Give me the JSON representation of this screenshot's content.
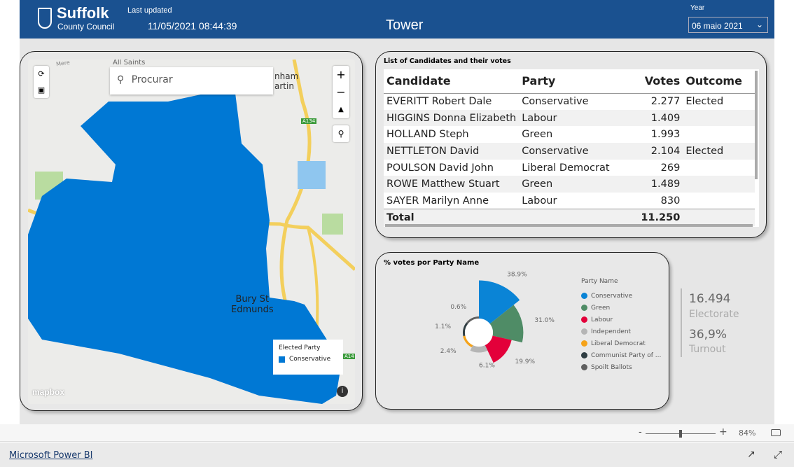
{
  "header": {
    "logo_line1": "Suffolk",
    "logo_line2": "County Council",
    "last_updated_label": "Last updated",
    "last_updated_value": "11/05/2021 08:44:39",
    "title": "Tower",
    "year_label": "Year",
    "year_value": "06 maio 2021"
  },
  "map": {
    "search_placeholder": "Procurar",
    "labels": [
      "All Saints",
      "Bury St\nEdmunds",
      "A134",
      "A14",
      "Mere",
      "nham\nartin"
    ],
    "legend_title": "Elected Party",
    "legend_item": "Conservative",
    "legend_color": "#0078d4",
    "attribution": "mapbox"
  },
  "table": {
    "title": "List of Candidates and their votes",
    "columns": [
      "Candidate",
      "Party",
      "Votes",
      "Outcome"
    ],
    "rows": [
      [
        "EVERITT Robert Dale",
        "Conservative",
        "2.277",
        "Elected"
      ],
      [
        "HIGGINS Donna Elizabeth",
        "Labour",
        "1.409",
        ""
      ],
      [
        "HOLLAND Steph",
        "Green",
        "1.993",
        ""
      ],
      [
        "NETTLETON David",
        "Conservative",
        "2.104",
        "Elected"
      ],
      [
        "POULSON David John",
        "Liberal Democrat",
        "269",
        ""
      ],
      [
        "ROWE Matthew Stuart",
        "Green",
        "1.489",
        ""
      ],
      [
        "SAYER Marilyn Anne",
        "Labour",
        "830",
        ""
      ]
    ],
    "total_label": "Total",
    "total_votes": "11.250"
  },
  "chart_data": {
    "type": "pie",
    "title": "% votes por Party Name",
    "legend_title": "Party Name",
    "legend_position": "right",
    "series": [
      {
        "name": "Conservative",
        "value": 38.9,
        "label": "38.9%",
        "color": "#0a84d6"
      },
      {
        "name": "Green",
        "value": 31.0,
        "label": "31.0%",
        "color": "#4f8c66"
      },
      {
        "name": "Labour",
        "value": 19.9,
        "label": "19.9%",
        "color": "#e3003a"
      },
      {
        "name": "Independent",
        "value": 6.1,
        "label": "6.1%",
        "color": "#b5b5b5"
      },
      {
        "name": "Liberal Democrat",
        "value": 2.4,
        "label": "2.4%",
        "color": "#f5a31a"
      },
      {
        "name": "Communist Party of ...",
        "value": 1.1,
        "label": "1.1%",
        "color": "#2f3d42"
      },
      {
        "name": "Spoilt Ballots",
        "value": 0.6,
        "label": "0.6%",
        "color": "#606060"
      }
    ]
  },
  "kpi": {
    "electorate_value": "16.494",
    "electorate_label": "Electorate",
    "turnout_value": "36,9%",
    "turnout_label": "Turnout"
  },
  "footer": {
    "zoom_minus": "-",
    "zoom_plus": "+",
    "zoom_level": "84%",
    "zoom_fraction": 0.5,
    "brand_link": "Microsoft Power BI"
  }
}
